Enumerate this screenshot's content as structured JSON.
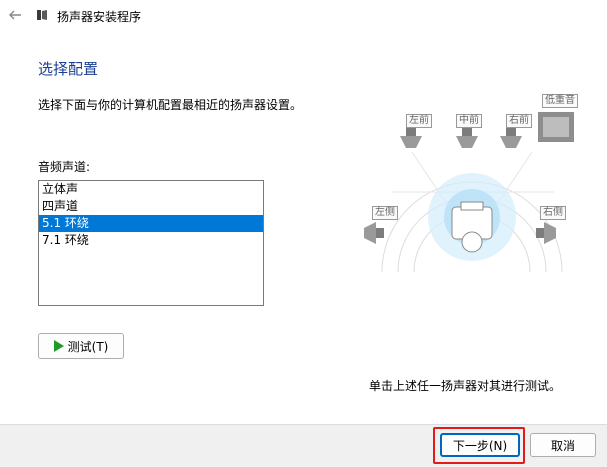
{
  "window": {
    "title": "扬声器安装程序"
  },
  "page": {
    "heading": "选择配置",
    "description": "选择下面与你的计算机配置最相近的扬声器设置。",
    "channels_label": "音频声道:",
    "channels": [
      "立体声",
      "四声道",
      "5.1 环绕",
      "7.1 环绕"
    ],
    "selected_channel": "5.1 环绕",
    "test_button": "测试(T)",
    "hint": "单击上述任一扬声器对其进行测试。"
  },
  "speakers": {
    "front_left": "左前",
    "center": "中前",
    "front_right": "右前",
    "subwoofer": "低重音",
    "side_left": "左侧",
    "side_right": "右侧"
  },
  "footer": {
    "next_button": "下一步(N)",
    "cancel_button": "取消"
  },
  "colors": {
    "heading": "#1b3f93",
    "selection": "#0078d7",
    "play": "#1e9a2a",
    "annotation": "#e21a1a"
  }
}
